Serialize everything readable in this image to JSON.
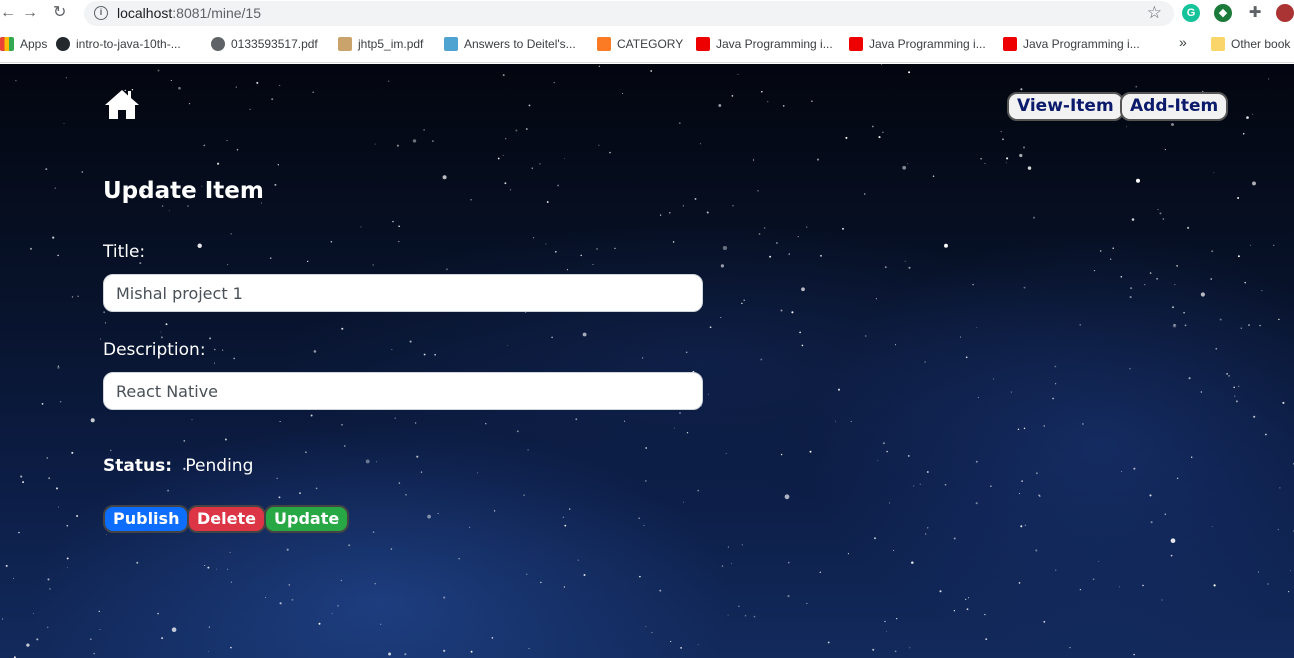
{
  "browser": {
    "url_host": "localhost",
    "url_path": ":8081/mine/15",
    "bookmarks": [
      {
        "label": "Apps",
        "icon": "apps-grid-icon"
      },
      {
        "label": "intro-to-java-10th-...",
        "icon": "github-icon"
      },
      {
        "label": "0133593517.pdf",
        "icon": "globe-icon"
      },
      {
        "label": "jhtp5_im.pdf",
        "icon": "page-favicon"
      },
      {
        "label": "Answers to Deitel's...",
        "icon": "cs-favicon"
      },
      {
        "label": "CATEGORY",
        "icon": "xampp-icon"
      },
      {
        "label": "Java Programming i...",
        "icon": "youtube-icon"
      },
      {
        "label": "Java Programming i...",
        "icon": "youtube-icon"
      },
      {
        "label": "Java Programming i...",
        "icon": "youtube-icon"
      },
      {
        "label": "Other book",
        "icon": "folder-icon"
      }
    ],
    "more_label": "»"
  },
  "nav": {
    "view_item": "View-Item",
    "add_item": "Add-Item"
  },
  "form": {
    "heading": "Update Item",
    "title_label": "Title:",
    "title_value": "Mishal project 1",
    "description_label": "Description:",
    "description_value": "React Native",
    "status_label": "Status:",
    "status_value": "Pending"
  },
  "actions": {
    "publish": "Publish",
    "delete": "Delete",
    "update": "Update"
  },
  "colors": {
    "publish": "#0d6efd",
    "delete": "#dc3545",
    "update": "#28a745"
  }
}
